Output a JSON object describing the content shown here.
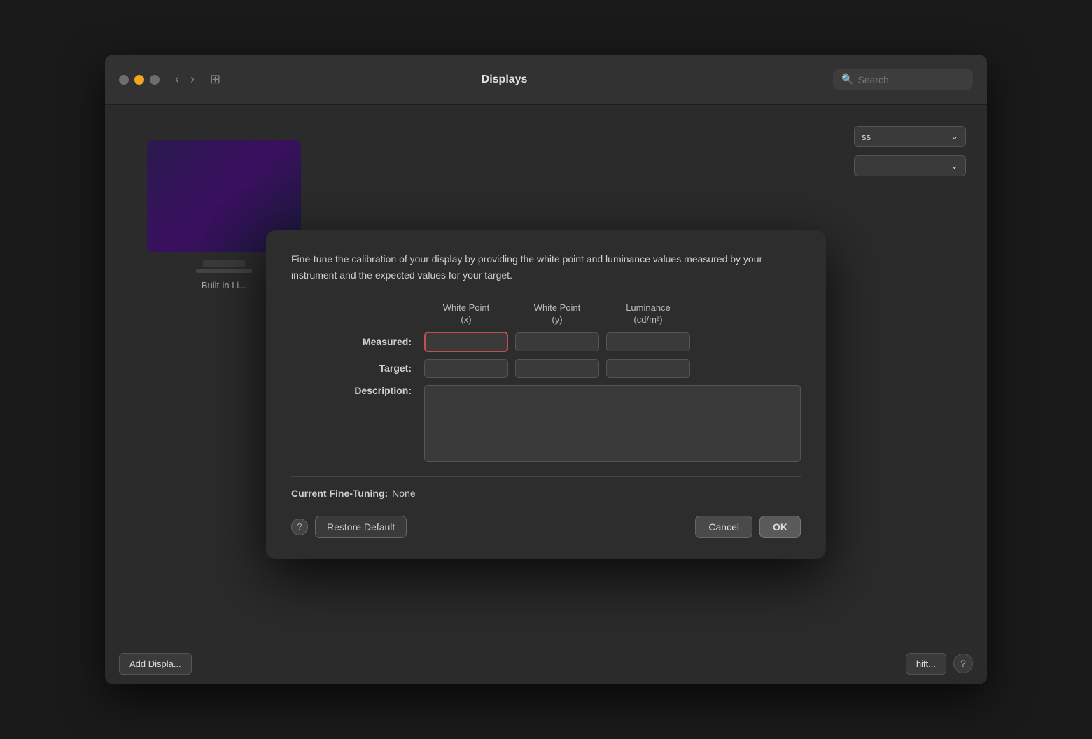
{
  "window": {
    "title": "Displays"
  },
  "search": {
    "placeholder": "Search"
  },
  "trafficLights": {
    "close": "close",
    "minimize": "minimize",
    "maximize": "maximize"
  },
  "display": {
    "label": "Built-in Li..."
  },
  "modal": {
    "description": "Fine-tune the calibration of your display by providing the white point and luminance values measured by your instrument and the expected values for your target.",
    "columns": {
      "whitePointX": "White Point\n(x)",
      "whitePointY": "White Point\n(y)",
      "luminance": "Luminance\n(cd/m²)"
    },
    "rows": {
      "measured": "Measured:",
      "target": "Target:",
      "description": "Description:"
    },
    "fineTuningLabel": "Current Fine-Tuning:",
    "fineTuningValue": "None",
    "buttons": {
      "help": "?",
      "restoreDefault": "Restore Default",
      "cancel": "Cancel",
      "ok": "OK"
    }
  },
  "bottomBar": {
    "addDisplay": "Add Displa...",
    "shortcut": "hift...",
    "help": "?"
  }
}
